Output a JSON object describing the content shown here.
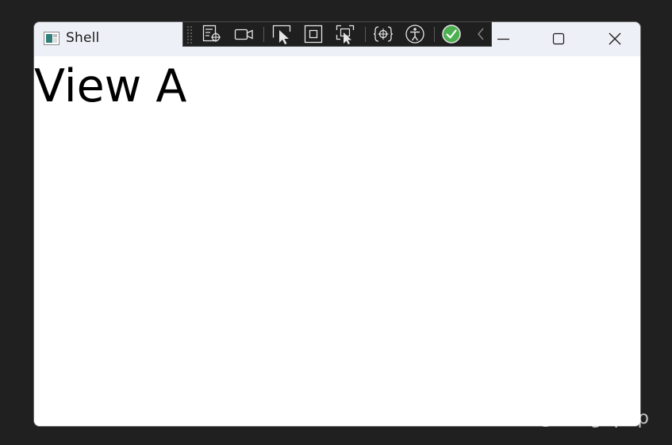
{
  "window": {
    "title": "Shell",
    "app_icon": "window-app-icon",
    "controls": {
      "minimize_icon": "minimize-icon",
      "maximize_icon": "maximize-icon",
      "close_icon": "close-icon"
    }
  },
  "content": {
    "view_label": "View A"
  },
  "debug_toolbar": {
    "tools": [
      {
        "icon": "drag-handle-icon"
      },
      {
        "icon": "live-visual-tree-icon"
      },
      {
        "icon": "record-video-icon"
      },
      {
        "icon": "select-element-icon"
      },
      {
        "icon": "display-layout-adorners-icon"
      },
      {
        "icon": "track-focused-element-icon"
      },
      {
        "icon": "binding-failures-icon"
      },
      {
        "icon": "accessibility-icon"
      },
      {
        "icon": "hot-reload-status-icon"
      },
      {
        "icon": "collapse-toolbar-icon"
      }
    ]
  },
  "watermark": {
    "text": "知乎 @mingupup"
  },
  "colors": {
    "desktop": "#202020",
    "titlebar": "#eef0f7",
    "toolbar": "#1f1f1f",
    "status_ok": "#4caf50"
  }
}
